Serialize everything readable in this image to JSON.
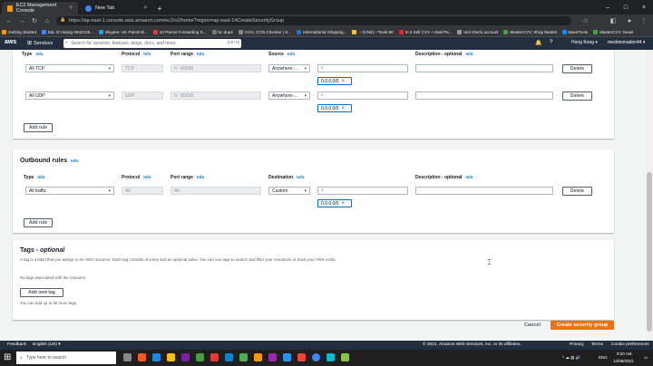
{
  "browser": {
    "tabs": [
      {
        "title": "EC2 Management Console",
        "icon": "aws-favicon",
        "color": "#ff9900"
      },
      {
        "title": "New Tab",
        "icon": "chrome-favicon",
        "color": "#4285f4"
      }
    ],
    "new_tab_icon": "+",
    "url": "https://ap-east-1.console.aws.amazon.com/ec2/v2/home?region=ap-east-1#CreateSecurityGroup",
    "bookmarks": [
      "Getting Started",
      "bác sĩ Hoàng 0942138...",
      "Skypee: UK Parcel B...",
      "10 Parcel Forwarding S...",
      "bc dups",
      "CCN, CCN Checker | S...",
      "International Shipping...",
      "---(VN2)---Tools 90",
      "m tr.Sell CVV + Mail Pa...",
      "tool check account",
      "MasterCVV: Shop basket",
      "BaseTools",
      "MasterCVV: News"
    ]
  },
  "aws_nav": {
    "logo": "aws",
    "services": "Services",
    "search_placeholder": "Search for services, features, blogs, docs, and more",
    "search_shortcut": "[Alt+S]",
    "region": "Hong Kong",
    "account": "medotomadon44"
  },
  "inbound": {
    "headers": {
      "type": "Type",
      "protocol": "Protocol",
      "port": "Port range",
      "source": "Source",
      "description": "Description - optional",
      "info": "Info"
    },
    "rows": [
      {
        "type": "All TCP",
        "protocol": "TCP",
        "port": "0 - 65535",
        "source": "Anywhere-...",
        "cidr": "0.0.0.0/0",
        "delete": "Delete"
      },
      {
        "type": "All UDP",
        "protocol": "UDP",
        "port": "0 - 65535",
        "source": "Anywhere-...",
        "cidr": "0.0.0.0/0",
        "delete": "Delete"
      }
    ],
    "add_rule": "Add rule"
  },
  "outbound": {
    "title": "Outbound rules",
    "info": "Info",
    "headers": {
      "type": "Type",
      "protocol": "Protocol",
      "port": "Port range",
      "destination": "Destination",
      "description": "Description - optional"
    },
    "row": {
      "type": "All traffic",
      "protocol": "All",
      "port": "All",
      "destination": "Custom",
      "cidr": "0.0.0.0/0",
      "delete": "Delete"
    },
    "add_rule": "Add rule"
  },
  "tags": {
    "title": "Tags",
    "optional": "optional",
    "description": "A tag is a label that you assign to an AWS resource. Each tag consists of a key and an optional value. You can use tags to search and filter your resources or track your AWS costs.",
    "empty": "No tags associated with the resource.",
    "add_tag": "Add new tag",
    "limit": "You can add up to 50 more tags"
  },
  "actions": {
    "cancel": "Cancel",
    "create": "Create security group"
  },
  "footer": {
    "feedback": "Feedback",
    "language": "English (US)",
    "copyright": "© 2021, Amazon Web Services, Inc. or its affiliates.",
    "privacy": "Privacy",
    "terms": "Terms",
    "cookies": "Cookie preferences"
  },
  "taskbar": {
    "search_placeholder": "Type here to search",
    "lang": "ENG",
    "time": "9:20 AM",
    "date": "12/08/2021"
  },
  "colors": {
    "primary": "#ec7211",
    "link": "#0073bb",
    "aws_nav": "#232f3e"
  }
}
